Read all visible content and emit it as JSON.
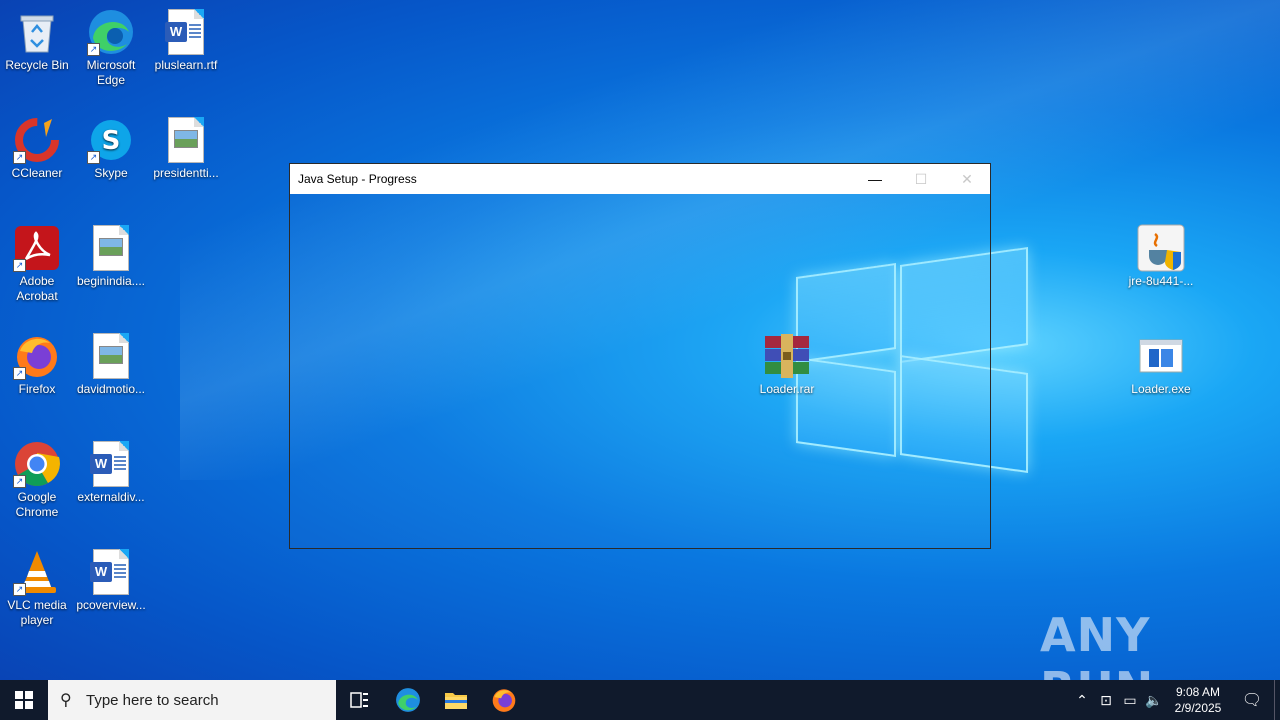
{
  "desktop": {
    "icons": [
      {
        "label": "Recycle Bin",
        "icon": "recycle-bin-icon"
      },
      {
        "label": "Microsoft Edge",
        "icon": "edge-icon"
      },
      {
        "label": "pluslearn.rtf",
        "icon": "word-doc-icon"
      },
      {
        "label": "CCleaner",
        "icon": "ccleaner-icon"
      },
      {
        "label": "Skype",
        "icon": "skype-icon"
      },
      {
        "label": "presidentti...",
        "icon": "image-file-icon"
      },
      {
        "label": "Adobe Acrobat",
        "icon": "acrobat-icon"
      },
      {
        "label": "beginindia....",
        "icon": "image-file-icon"
      },
      {
        "label": "Firefox",
        "icon": "firefox-icon"
      },
      {
        "label": "davidmotio...",
        "icon": "image-file-icon"
      },
      {
        "label": "Google Chrome",
        "icon": "chrome-icon"
      },
      {
        "label": "externaldiv...",
        "icon": "word-doc-icon"
      },
      {
        "label": "VLC media player",
        "icon": "vlc-icon"
      },
      {
        "label": "pcoverview...",
        "icon": "word-doc-icon"
      },
      {
        "label": "Loader.rar",
        "icon": "winrar-archive-icon"
      },
      {
        "label": "jre-8u441-...",
        "icon": "java-installer-icon"
      },
      {
        "label": "Loader.exe",
        "icon": "exe-file-icon"
      }
    ]
  },
  "window": {
    "title": "Java Setup - Progress",
    "minimize": "—",
    "maximize": "☐",
    "close": "✕"
  },
  "taskbar": {
    "search_placeholder": "Type here to search",
    "time": "9:08 AM",
    "date": "2/9/2025"
  },
  "watermark": "ANY RUN"
}
